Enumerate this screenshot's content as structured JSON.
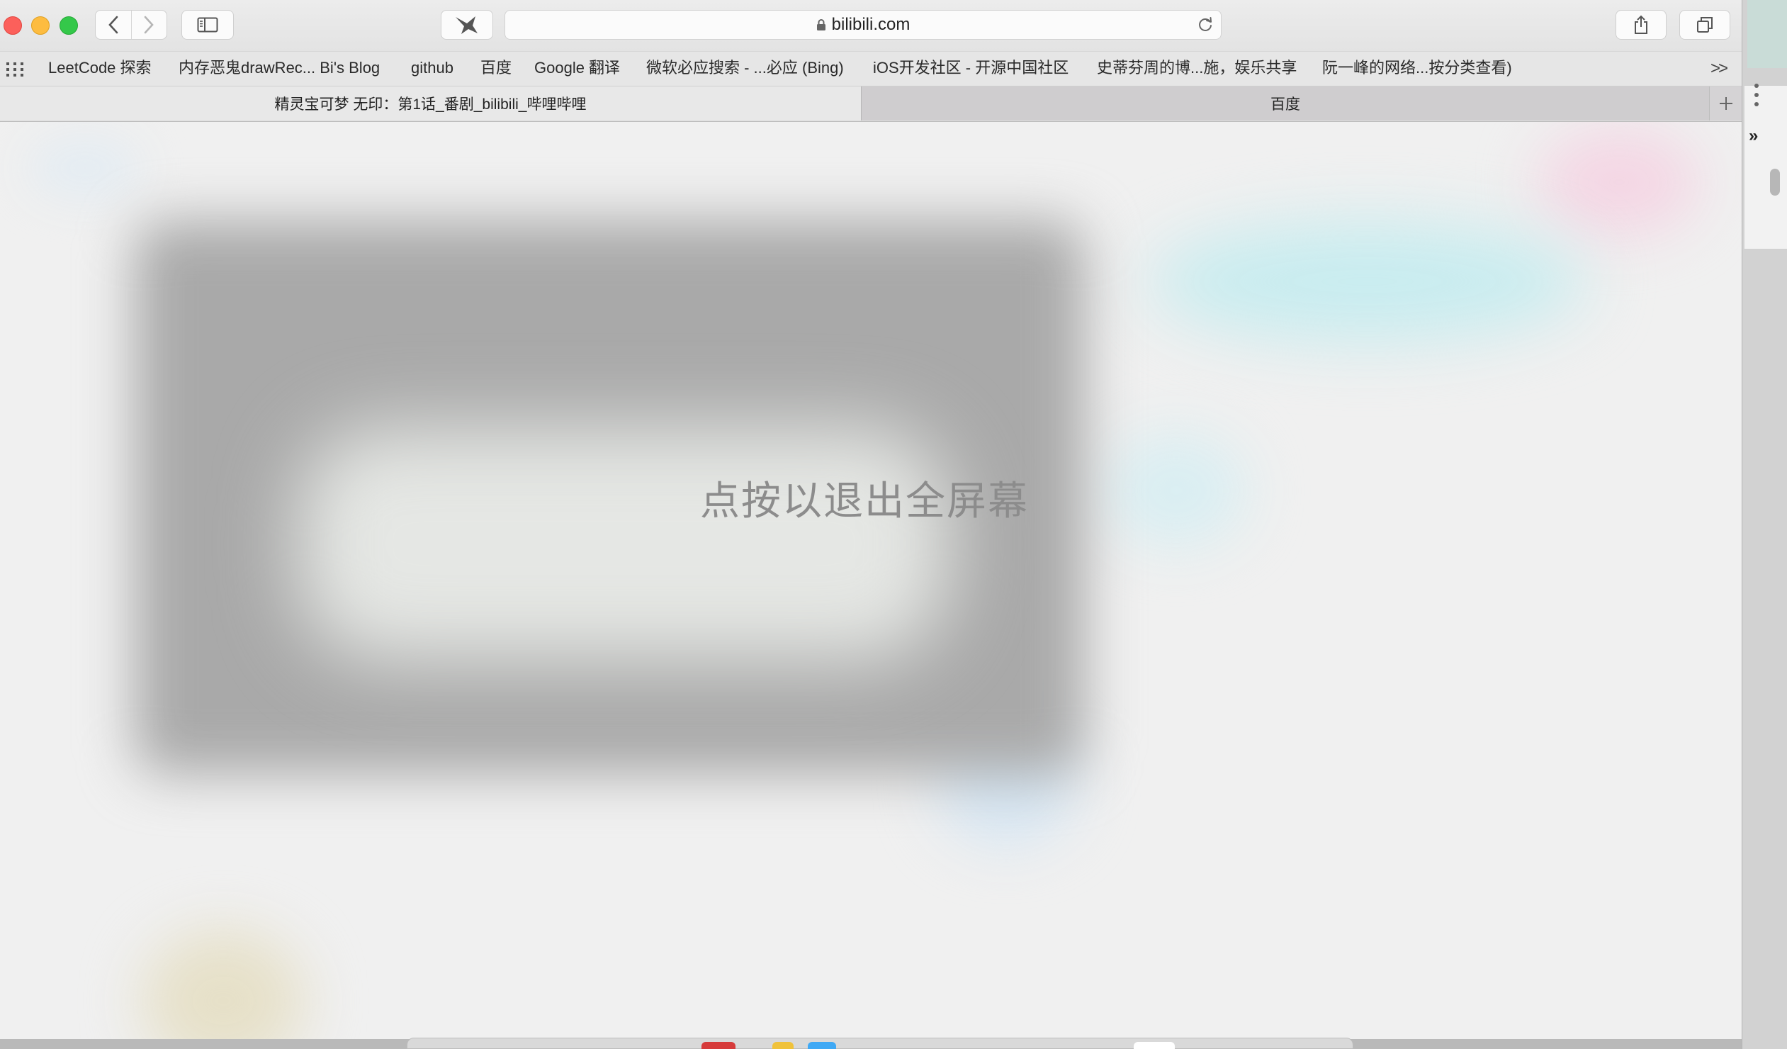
{
  "window": {
    "url": "bilibili.com"
  },
  "bookmarks": [
    "LeetCode 探索",
    "内存恶鬼drawRec... Bi's Blog",
    "github",
    "百度",
    "Google 翻译",
    "微软必应搜索 - ...必应 (Bing)",
    "iOS开发社区 - 开源中国社区",
    "史蒂芬周的博...施，娱乐共享",
    "阮一峰的网络...按分类查看)"
  ],
  "bookmarks_more": ">>",
  "tabs": [
    {
      "title": "精灵宝可梦 无印：第1话_番剧_bilibili_哔哩哔哩",
      "active": true
    },
    {
      "title": "百度",
      "active": false
    }
  ],
  "content": {
    "exit_fullscreen_hint": "点按以退出全屏幕"
  },
  "side": {
    "chevron": "»"
  },
  "icons": {
    "traffic_lights": [
      "close-icon",
      "minimize-icon",
      "zoom-icon"
    ],
    "toolbar": [
      "back-icon",
      "forward-icon",
      "sidebar-icon",
      "extension-bird-icon",
      "lock-icon",
      "reload-icon",
      "share-icon",
      "tabs-overview-icon",
      "bookmarks-grid-icon",
      "new-tab-plus-icon"
    ]
  },
  "colors": {
    "close": "#fc605b",
    "minimize": "#fdbc40",
    "zoom": "#34c84a",
    "video_blur": "#a9a9a9",
    "hint_text": "#8c8c8c"
  }
}
